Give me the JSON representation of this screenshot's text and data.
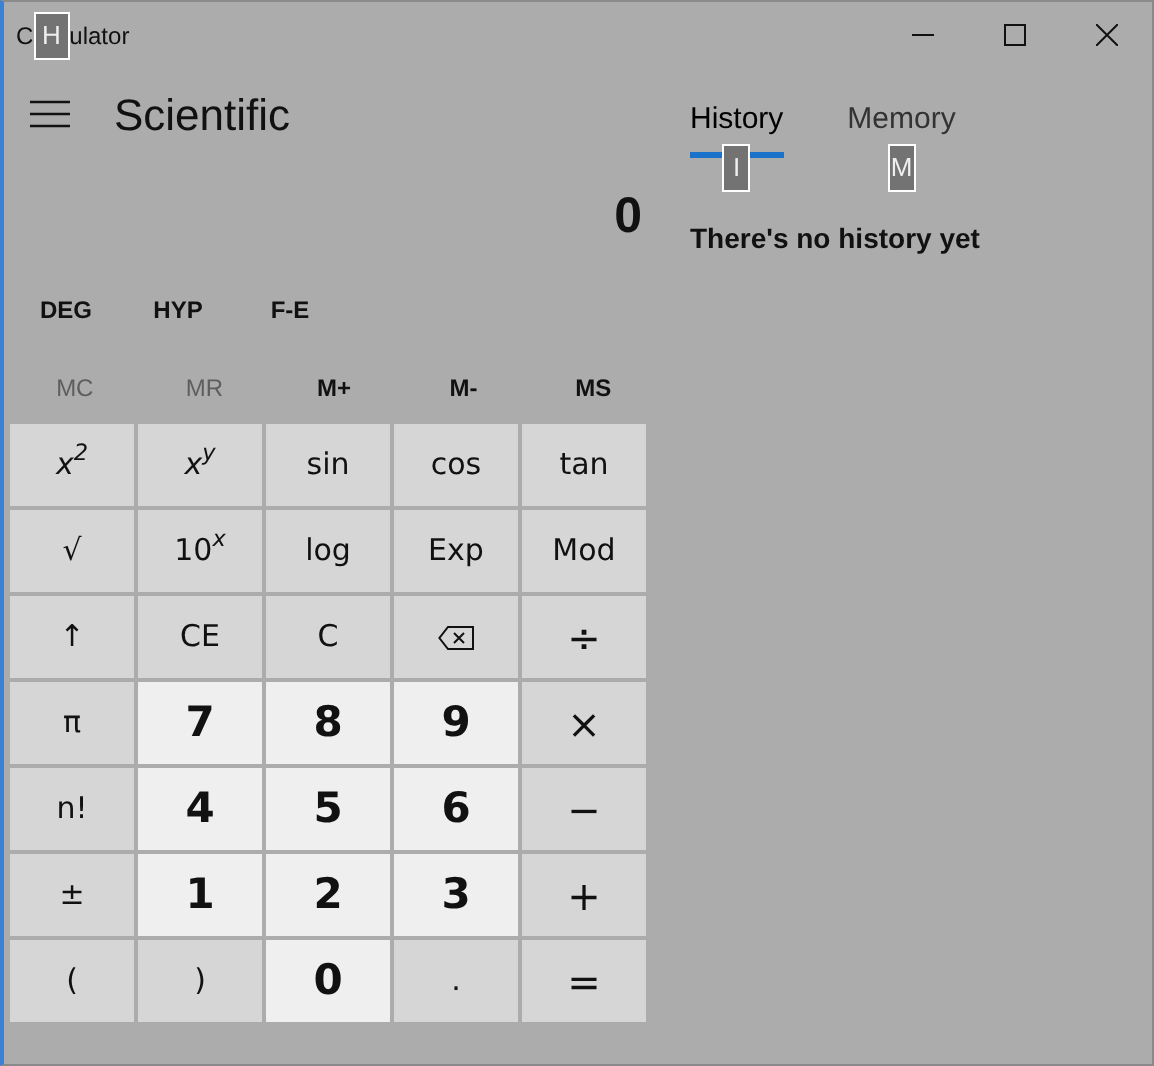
{
  "window": {
    "title_start": "C",
    "title_keytip": "H",
    "title_end": "ulator"
  },
  "mode": "Scientific",
  "display": "0",
  "angle_buttons": [
    "DEG",
    "HYP",
    "F-E"
  ],
  "memory_buttons": [
    {
      "label": "MC",
      "disabled": true
    },
    {
      "label": "MR",
      "disabled": true
    },
    {
      "label": "M+",
      "disabled": false
    },
    {
      "label": "M-",
      "disabled": false
    },
    {
      "label": "MS",
      "disabled": false
    }
  ],
  "keys": [
    {
      "kind": "function",
      "label": "*x*$^{2}$"
    },
    {
      "kind": "function",
      "label": "*x*$^{y}$"
    },
    {
      "kind": "function",
      "label": "sin"
    },
    {
      "kind": "function",
      "label": "cos"
    },
    {
      "kind": "function",
      "label": "tan"
    },
    {
      "kind": "function",
      "label": "√"
    },
    {
      "kind": "function",
      "label": "10$^{x}$"
    },
    {
      "kind": "function",
      "label": "log"
    },
    {
      "kind": "function",
      "label": "Exp"
    },
    {
      "kind": "function",
      "label": "Mod"
    },
    {
      "kind": "function",
      "label": "↑"
    },
    {
      "kind": "function",
      "label": "CE"
    },
    {
      "kind": "function",
      "label": "C"
    },
    {
      "kind": "backspace"
    },
    {
      "kind": "operator",
      "label": "÷"
    },
    {
      "kind": "function",
      "label": "π"
    },
    {
      "kind": "digit",
      "label": "7"
    },
    {
      "kind": "digit",
      "label": "8"
    },
    {
      "kind": "digit",
      "label": "9"
    },
    {
      "kind": "operator",
      "label": "×"
    },
    {
      "kind": "function",
      "label": "n!"
    },
    {
      "kind": "digit",
      "label": "4"
    },
    {
      "kind": "digit",
      "label": "5"
    },
    {
      "kind": "digit",
      "label": "6"
    },
    {
      "kind": "operator",
      "label": "−"
    },
    {
      "kind": "function",
      "label": "±"
    },
    {
      "kind": "digit",
      "label": "1"
    },
    {
      "kind": "digit",
      "label": "2"
    },
    {
      "kind": "digit",
      "label": "3"
    },
    {
      "kind": "operator",
      "label": "+"
    },
    {
      "kind": "function",
      "label": "("
    },
    {
      "kind": "function",
      "label": ")"
    },
    {
      "kind": "digit",
      "label": "0"
    },
    {
      "kind": "function",
      "label": "."
    },
    {
      "kind": "operator",
      "label": "="
    }
  ],
  "panel_tabs": [
    {
      "label": "History",
      "selected": true,
      "keytip": "I"
    },
    {
      "label": "Memory",
      "selected": false,
      "keytip": "M"
    }
  ],
  "history_empty": "There's no history yet"
}
